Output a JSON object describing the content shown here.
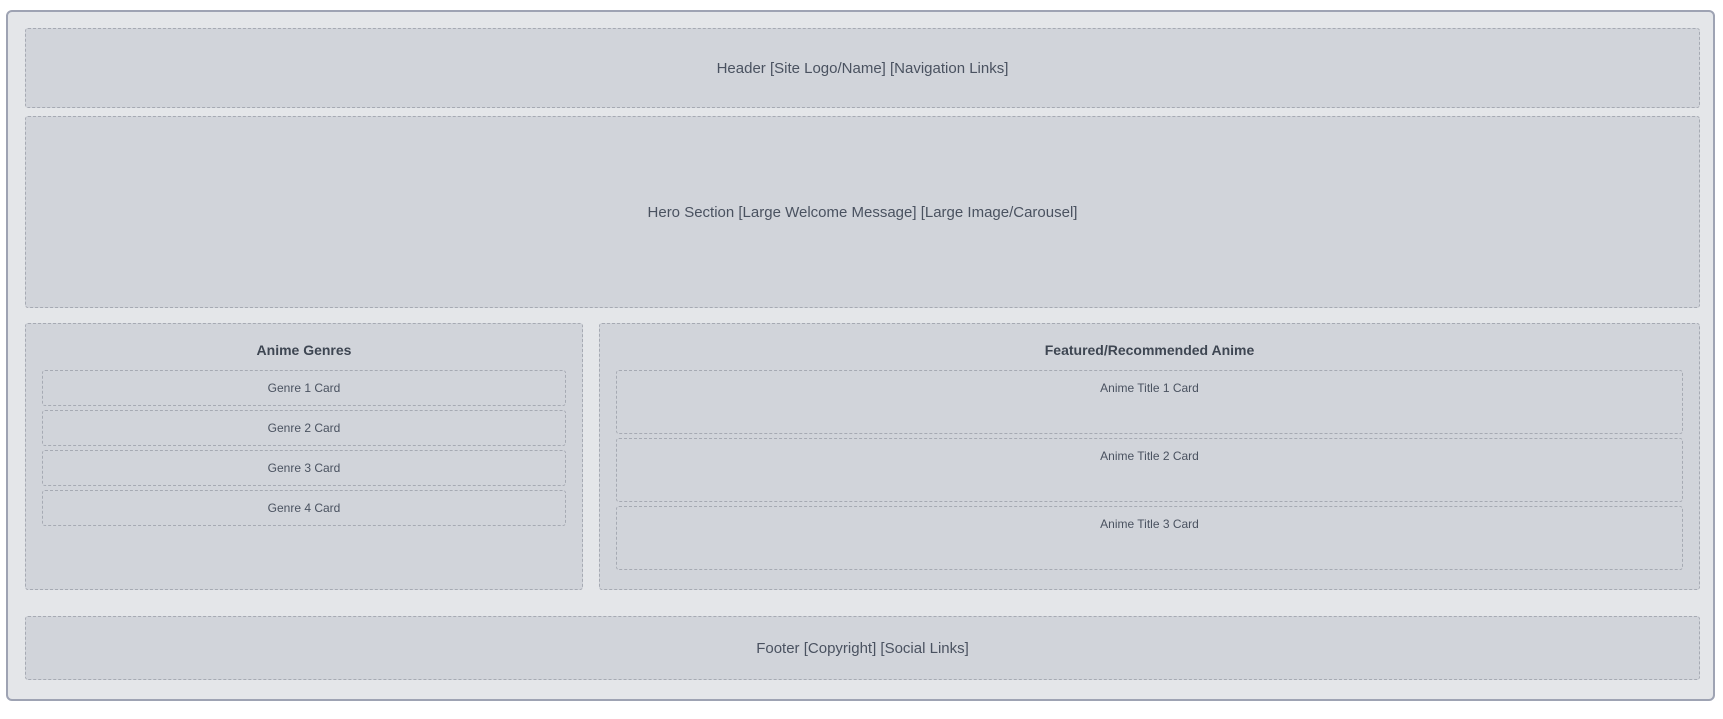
{
  "header": {
    "label": "Header [Site Logo/Name] [Navigation Links]"
  },
  "hero": {
    "label": "Hero Section [Large Welcome Message] [Large Image/Carousel]"
  },
  "genres": {
    "title": "Anime Genres",
    "cards": [
      "Genre 1 Card",
      "Genre 2 Card",
      "Genre 3 Card",
      "Genre 4 Card"
    ]
  },
  "featured": {
    "title": "Featured/Recommended Anime",
    "cards": [
      "Anime Title 1 Card",
      "Anime Title 2 Card",
      "Anime Title 3 Card"
    ]
  },
  "footer": {
    "label": "Footer [Copyright] [Social Links]"
  }
}
